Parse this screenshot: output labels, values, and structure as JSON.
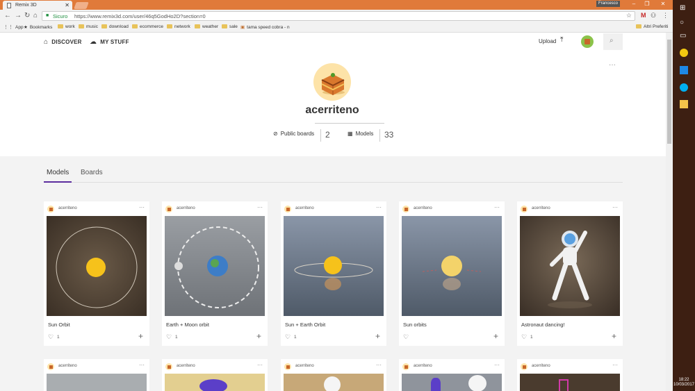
{
  "browser": {
    "tab_title": "Remix 3D",
    "tab_close": "✕",
    "profile_name": "Francesco",
    "secure_label": "Sicuro",
    "url": "https://www.remix3d.com/user/46q5GodHo2D?section=0",
    "bookmarks": [
      {
        "label": "App",
        "icon": "apps-icon"
      },
      {
        "label": "Bookmarks",
        "icon": "star-icon"
      },
      {
        "label": "work",
        "icon": "folder-icon"
      },
      {
        "label": "music",
        "icon": "folder-icon"
      },
      {
        "label": "download",
        "icon": "folder-icon"
      },
      {
        "label": "ecommerce",
        "icon": "folder-icon"
      },
      {
        "label": "network",
        "icon": "folder-icon"
      },
      {
        "label": "weather",
        "icon": "folder-icon"
      },
      {
        "label": "sale",
        "icon": "folder-icon"
      },
      {
        "label": "tama speed cobra - n",
        "icon": "page-icon"
      }
    ],
    "other_bookmarks": "Altri Preferiti"
  },
  "nav": {
    "discover": "DISCOVER",
    "my_stuff": "MY STUFF",
    "upload": "Upload"
  },
  "profile": {
    "username": "acerriteno",
    "public_boards_label": "Public boards",
    "public_boards_count": "2",
    "models_label": "Models",
    "models_count": "33"
  },
  "tabs": {
    "models": "Models",
    "boards": "Boards"
  },
  "cards": [
    {
      "author": "acerriteno",
      "title": "Sun Orbit",
      "likes": "1"
    },
    {
      "author": "acerriteno",
      "title": "Earth + Moon orbit",
      "likes": "1"
    },
    {
      "author": "acerriteno",
      "title": "Sun + Earth Orbit",
      "likes": "1"
    },
    {
      "author": "acerriteno",
      "title": "Sun orbits",
      "likes": ""
    },
    {
      "author": "acerriteno",
      "title": "Astronaut dancing!",
      "likes": "1"
    }
  ],
  "cards_row2": [
    {
      "author": "acerriteno"
    },
    {
      "author": "acerriteno"
    },
    {
      "author": "acerriteno"
    },
    {
      "author": "acerriteno"
    },
    {
      "author": "acerriteno"
    }
  ],
  "taskbar": {
    "time": "18:22",
    "date": "10/03/2017"
  },
  "colors": {
    "accent_tab": "#5b2c9e",
    "chrome_frame": "#e07a3a",
    "taskbar": "#3d1f12"
  }
}
